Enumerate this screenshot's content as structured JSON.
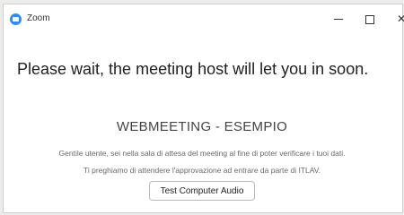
{
  "window": {
    "title": "Zoom",
    "app_icon": "zoom-camera-icon",
    "controls": {
      "minimize": "minimize-icon",
      "maximize": "maximize-icon",
      "close_glyph": "✕"
    }
  },
  "waiting_room": {
    "headline": "Please wait, the meeting host will let you in soon.",
    "meeting_title": "WEBMEETING - ESEMPIO",
    "message_line1": "Gentile utente, sei nella sala di attesa del meeting al fine di poter verificare i tuoi dati.",
    "message_line2": "Ti preghiamo di attendere l'approvazione ad entrare da parte di ITLAV.",
    "test_audio_button": "Test Computer Audio"
  },
  "colors": {
    "accent": "#2d8cff"
  }
}
